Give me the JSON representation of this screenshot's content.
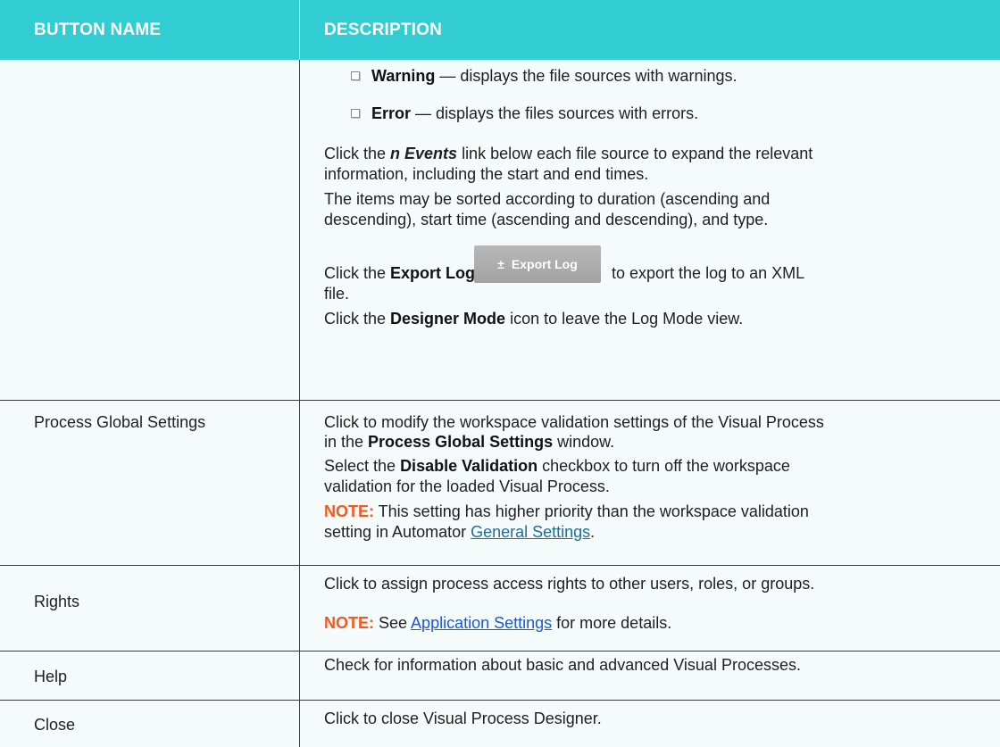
{
  "header": {
    "col1": "BUTTON NAME",
    "col2": "DESCRIPTION"
  },
  "log_row": {
    "bullets": [
      {
        "bold": "Warning",
        "text": " — displays the file sources with warnings."
      },
      {
        "bold": "Error",
        "text": " — displays the files sources with errors."
      }
    ],
    "para1": {
      "pre": "Click the ",
      "emph": "n Events",
      "post": " link below each file source to expand the relevant",
      "line2": "information, including the start and end times."
    },
    "para2": {
      "line1": "The items may be sorted according to duration (ascending and",
      "line2": "descending), start time (ascending and descending), and type."
    },
    "export": {
      "pre": "Click the ",
      "bold": "Export Log",
      "mid": " button",
      "post": "to export the log to an XML",
      "line2": "file.",
      "button_icon": "±",
      "button_label": "Export Log"
    },
    "designer": {
      "pre": "Click the ",
      "bold": "Designer Mode",
      "post": " icon to leave the Log Mode view."
    }
  },
  "global_row": {
    "name": "Process Global Settings",
    "p1": {
      "line1": "Click to modify the workspace validation settings of the Visual Process",
      "line2_pre": "in  the ",
      "line2_bold": "Process Global Settings",
      "line2_post": " window."
    },
    "p2": {
      "pre": "Select the ",
      "bold": "Disable Validation",
      "post": " checkbox to turn off the workspace",
      "line2": "validation for the loaded Visual Process."
    },
    "note": {
      "label": "NOTE:",
      "line1": " This setting has higher priority than the workspace validation",
      "line2_pre": "setting in Automator ",
      "link": "General Settings",
      "line2_post": "."
    }
  },
  "rights_row": {
    "name": "Rights",
    "desc": "Click to assign process access rights to other users, roles, or groups.",
    "note": {
      "label": "NOTE:",
      "pre": " See ",
      "link": "Application Settings",
      "post": " for more details."
    }
  },
  "help_row": {
    "name": "Help",
    "desc": "Check for information about basic and advanced Visual Processes."
  },
  "close_row": {
    "name": "Close",
    "desc": "Click to close Visual Process Designer."
  },
  "colors": {
    "header_bg": "#31cdd3",
    "row_bg": "#f5fafb",
    "note": "#f05a22",
    "link": "#1a58d6"
  }
}
